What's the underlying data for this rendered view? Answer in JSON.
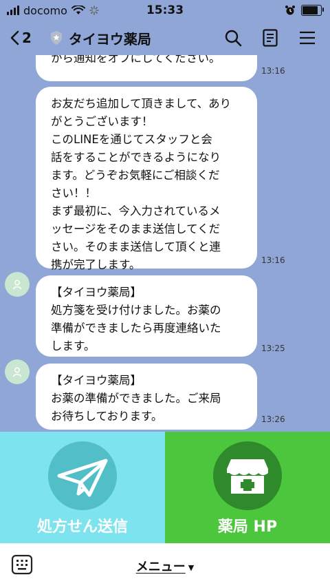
{
  "status_bar": {
    "carrier": "docomo",
    "time": "15:33",
    "battery_level": 0.85
  },
  "header": {
    "back_count": "2",
    "title": "タイヨウ薬局"
  },
  "messages": [
    {
      "text": "から通知をオフにしてください。",
      "time": "13:16"
    },
    {
      "text": "お友だち追加して頂きまして、あり\nがとうございます！\nこのLINEを通じてスタッフと会\n話をすることができるようになり\nます。どうぞお気軽にご相談くだ\nさい！！\nまず最初に、今入力されているメ\nッセージをそのまま送信してくだ\nさい。そのまま送信して頂くと連\n携が完了します。",
      "time": "13:16"
    },
    {
      "text": "【タイヨウ薬局】\n処方箋を受け付けました。お薬の\n準備ができましたら再度連絡いた\nします。",
      "time": "13:25"
    },
    {
      "text": "【タイヨウ薬局】\nお薬の準備ができました。ご来局\nお待ちしております。",
      "time": "13:26"
    }
  ],
  "rich_menu": {
    "left_label": "処方せん送信",
    "right_label": "薬局 HP"
  },
  "bottom": {
    "menu_label": "メニュー",
    "caret": "▼"
  }
}
